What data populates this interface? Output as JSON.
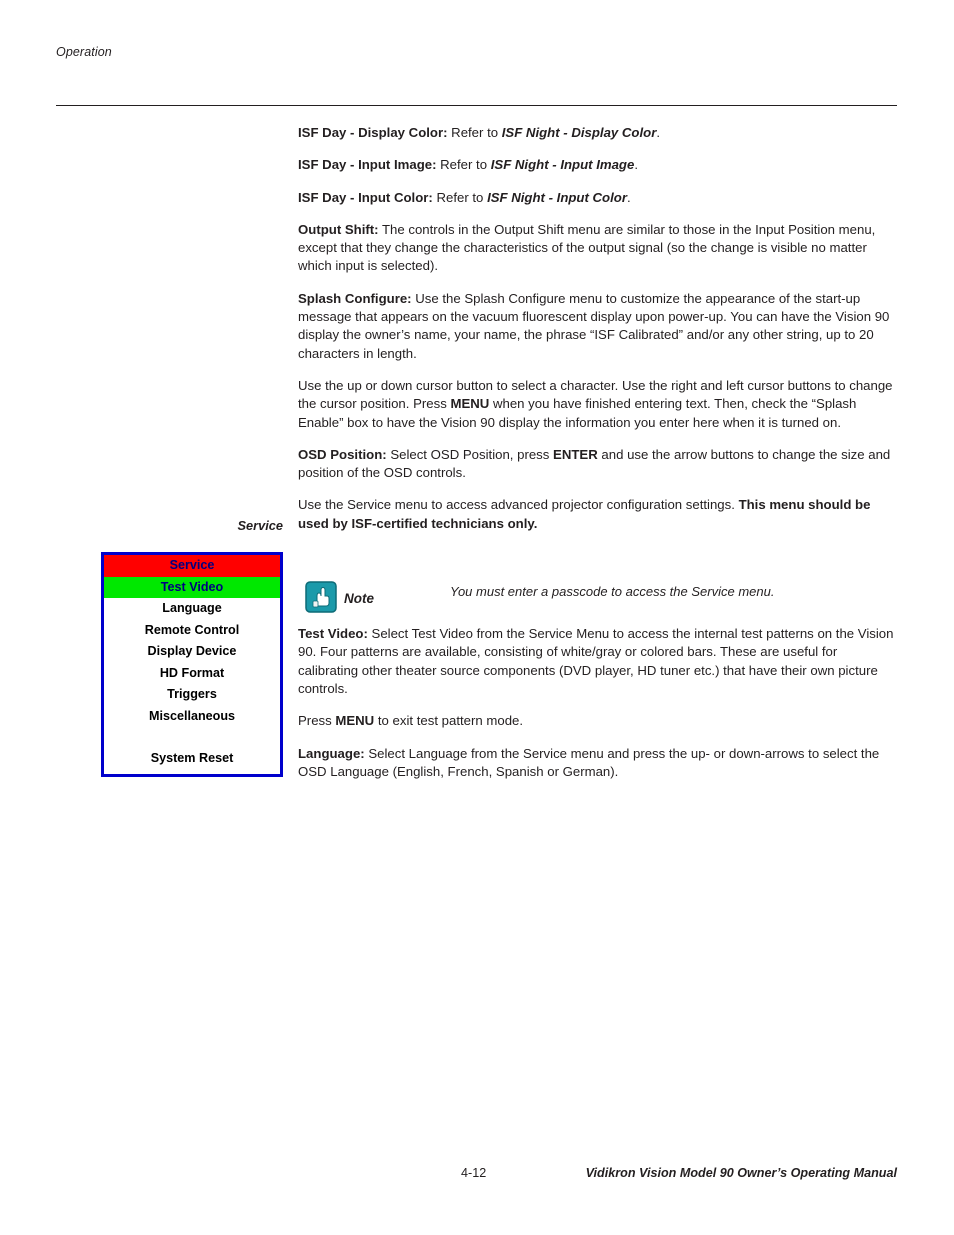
{
  "header": {
    "section_label": "Operation"
  },
  "margin": {
    "service_heading": "Service"
  },
  "osd_menu": {
    "title": "Service",
    "highlighted_item": "Test Video",
    "items": [
      "Language",
      "Remote Control",
      "Display Device",
      "HD Format",
      "Triggers",
      "Miscellaneous"
    ],
    "last_item": "System Reset",
    "colors": {
      "border": "#0000cc",
      "title_bg": "#ff0000",
      "highlight_bg": "#00e800",
      "text": "#000080"
    }
  },
  "body": {
    "p1": {
      "lead": "ISF Day - Display Color:",
      "text": " Refer to ",
      "ref": "ISF Night - Display Color",
      "end": "."
    },
    "p2": {
      "lead": "ISF Day - Input Image:",
      "text": " Refer to ",
      "ref": "ISF Night - Input Image",
      "end": "."
    },
    "p3": {
      "lead": "ISF Day - Input Color:",
      "text": " Refer to ",
      "ref": "ISF Night - Input Color",
      "end": "."
    },
    "p4": {
      "lead": "Output Shift:",
      "text": " The controls in the Output Shift menu are similar to those in the Input Position menu, except that they change the characteristics of the output signal (so the change is visible no matter which input is selected)."
    },
    "p5": {
      "lead": "Splash Configure:",
      "text": " Use the Splash Configure menu to customize the appearance of the start-up message that appears on the vacuum fluorescent display upon power-up. You can have the Vision 90 display the owner’s name, your name, the phrase “ISF Calibrated” and/or any other string, up to 20 characters in length."
    },
    "p6": {
      "t1": "Use the up or down cursor button to select a character. Use the right and left cursor buttons to change the cursor position. Press ",
      "b1": "MENU",
      "t2": " when you have finished entering text. Then, check the “Splash Enable” box to have the Vision 90 display the information you enter here when it is turned on."
    },
    "p7": {
      "lead": "OSD Position:",
      "t1": " Select OSD Position, press ",
      "b1": "ENTER",
      "t2": " and use the arrow buttons to change the size and position of the OSD controls."
    },
    "p8": {
      "t1": "Use the Service menu to access advanced projector configuration settings. ",
      "b1": "This menu should be used by ISF-certified technicians only."
    },
    "note": {
      "label": "Note",
      "icon": "note-hand-icon",
      "text": "You must enter a passcode to access the Service menu."
    },
    "p9": {
      "lead": "Test Video:",
      "text": " Select Test Video from the Service Menu to access the internal test patterns on the Vision 90. Four patterns are available, consisting of white/gray or colored bars. These are useful for calibrating other theater source components (DVD player, HD tuner etc.) that have their own picture controls."
    },
    "p10": {
      "t1": "Press ",
      "b1": "MENU",
      "t2": " to exit test pattern mode."
    },
    "p11": {
      "lead": "Language:",
      "text": " Select Language from the Service menu and press the up- or down-arrows to select the OSD Language (English, French, Spanish or German)."
    }
  },
  "footer": {
    "page_number": "4-12",
    "manual_title": "Vidikron Vision Model 90 Owner’s Operating Manual"
  }
}
